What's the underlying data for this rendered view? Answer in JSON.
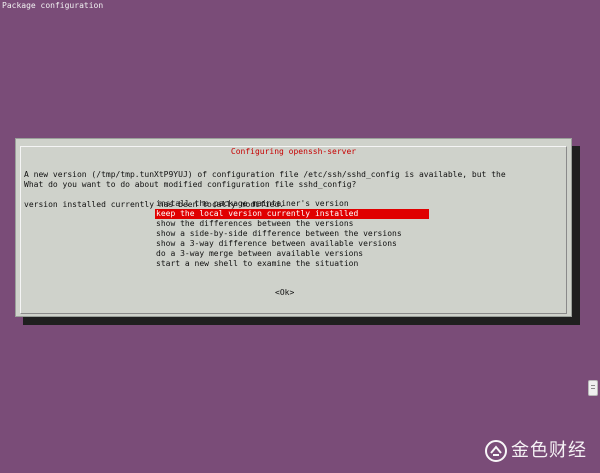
{
  "window": {
    "title": "Package configuration"
  },
  "dialog": {
    "title": "Configuring openssh-server",
    "message_lines": [
      "A new version (/tmp/tmp.tunXtP9YUJ) of configuration file /etc/ssh/sshd_config is available, but the",
      "version installed currently has been locally modified."
    ],
    "question": "What do you want to do about modified configuration file sshd_config?",
    "options": [
      "install the package maintainer's version",
      "keep the local version currently installed",
      "show the differences between the versions",
      "show a side-by-side difference between the versions",
      "show a 3-way difference between available versions",
      "do a 3-way merge between available versions",
      "start a new shell to examine the situation"
    ],
    "selected_index": 1,
    "ok_label": "<Ok>"
  },
  "watermark": {
    "text": "金色财经"
  },
  "colors": {
    "background": "#7a4c78",
    "dialog": "#cfd2cb",
    "title": "#c70000",
    "selected": "#e00000"
  }
}
